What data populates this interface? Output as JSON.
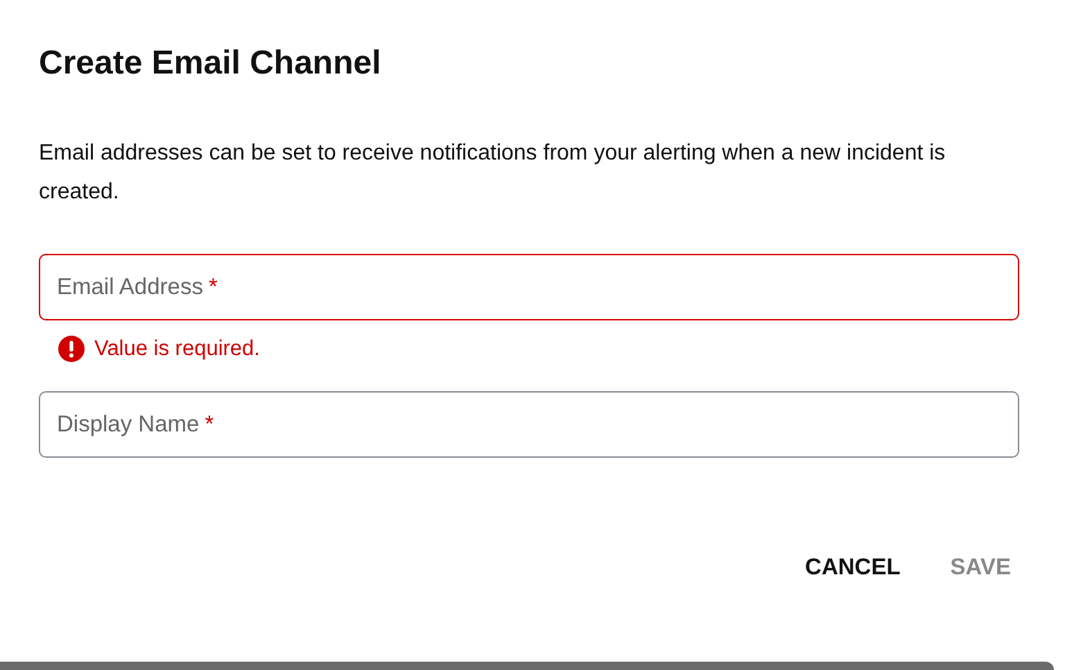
{
  "dialog": {
    "title": "Create Email Channel",
    "description": "Email addresses can be set to receive notifications from your alerting when a new incident is created.",
    "fields": [
      {
        "label": "Email Address",
        "required_mark": "*",
        "invalid": true,
        "error": "Value is required."
      },
      {
        "label": "Display Name",
        "required_mark": "*",
        "invalid": false
      }
    ],
    "buttons": [
      {
        "label": "CANCEL",
        "disabled": false
      },
      {
        "label": "SAVE",
        "disabled": true
      }
    ]
  }
}
